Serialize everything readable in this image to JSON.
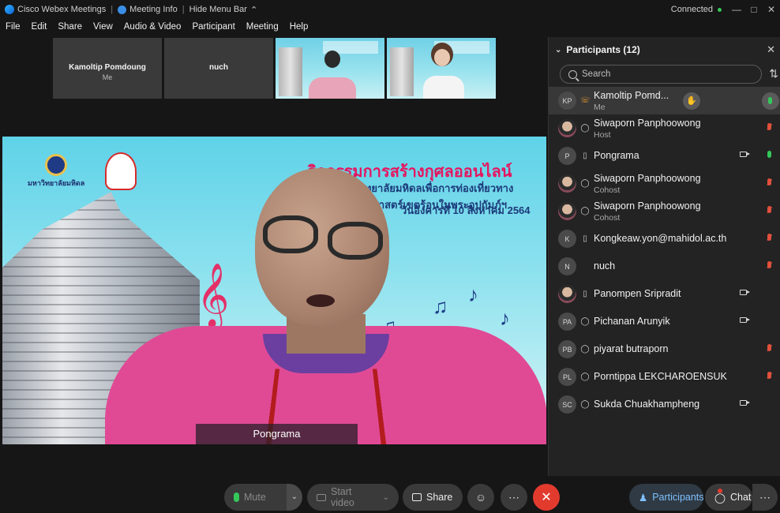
{
  "titlebar": {
    "app_name": "Cisco Webex Meetings",
    "meeting_info": "Meeting Info",
    "hide_menu": "Hide Menu Bar",
    "separator": "|",
    "connection": "Connected"
  },
  "menu": [
    "File",
    "Edit",
    "Share",
    "View",
    "Audio & Video",
    "Participant",
    "Meeting",
    "Help"
  ],
  "strip": [
    {
      "name": "Kamoltip Pomdoung",
      "sub": "Me"
    },
    {
      "name": "nuch",
      "sub": ""
    }
  ],
  "main_video": {
    "speaker": "Pongrama",
    "background_title": "กิจกรรมการสร้างกุศลออนไลน์",
    "background_subtitle": "...ทยาลัยมหิดลเพื่อการท่องเที่ยวทางเวชศาสตร์เขตร้อนในพระอุปถัมภ์ฯ",
    "background_date": "วันอังคารที่ 10 สิงหาคม 2564",
    "logo_text": "มหาวิทยาลัยมหิดล"
  },
  "panel": {
    "title": "Participants (12)",
    "search_placeholder": "Search",
    "participants": [
      {
        "initials": "KP",
        "name": "Kamoltip Pomd...",
        "role": "Me",
        "type": "phone-audio",
        "camera": false,
        "mic": "live",
        "selected": true,
        "photo": false
      },
      {
        "initials": "",
        "name": "Siwaporn Panphoowong",
        "role": "Host",
        "type": "headset",
        "camera": false,
        "mic": "muted",
        "selected": false,
        "photo": true
      },
      {
        "initials": "P",
        "name": "Pongrama",
        "role": "",
        "type": "mobile",
        "camera": true,
        "mic": "live",
        "selected": false,
        "photo": false
      },
      {
        "initials": "",
        "name": "Siwaporn Panphoowong",
        "role": "Cohost",
        "type": "headset",
        "camera": false,
        "mic": "muted",
        "selected": false,
        "photo": true
      },
      {
        "initials": "",
        "name": "Siwaporn Panphoowong",
        "role": "Cohost",
        "type": "headset",
        "camera": false,
        "mic": "muted",
        "selected": false,
        "photo": true
      },
      {
        "initials": "K",
        "name": "Kongkeaw.yon@mahidol.ac.th",
        "role": "",
        "type": "mobile",
        "camera": false,
        "mic": "muted",
        "selected": false,
        "photo": false
      },
      {
        "initials": "N",
        "name": "nuch",
        "role": "",
        "type": "",
        "camera": false,
        "mic": "muted",
        "selected": false,
        "photo": false
      },
      {
        "initials": "",
        "name": "Panompen Sripradit",
        "role": "",
        "type": "mobile",
        "camera": true,
        "mic": "",
        "selected": false,
        "photo": true
      },
      {
        "initials": "PA",
        "name": "Pichanan Arunyik",
        "role": "",
        "type": "headset",
        "camera": true,
        "mic": "",
        "selected": false,
        "photo": false
      },
      {
        "initials": "PB",
        "name": "piyarat butraporn",
        "role": "",
        "type": "headset",
        "camera": false,
        "mic": "muted",
        "selected": false,
        "photo": false
      },
      {
        "initials": "PL",
        "name": "Porntippa LEKCHAROENSUK",
        "role": "",
        "type": "headset",
        "camera": false,
        "mic": "muted",
        "selected": false,
        "photo": false
      },
      {
        "initials": "SC",
        "name": "Sukda Chuakhampheng",
        "role": "",
        "type": "headset",
        "camera": true,
        "mic": "",
        "selected": false,
        "photo": false
      }
    ]
  },
  "toolbar": {
    "mute": "Mute",
    "start_video": "Start video",
    "share": "Share",
    "participants": "Participants",
    "chat": "Chat"
  },
  "colors": {
    "accent": "#7fc0ff",
    "end_meeting": "#e23b2e",
    "mic_live": "#34c759",
    "mic_muted": "#e0503c",
    "shirt": "#e04a95"
  }
}
